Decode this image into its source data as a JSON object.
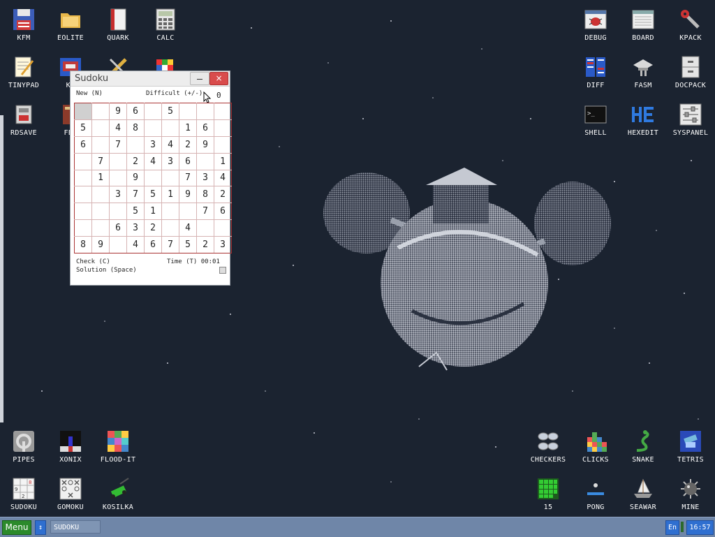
{
  "colors": {
    "desktop": "#1b2330",
    "taskbar": "#6f86a8",
    "menu_green": "#2b8a2b",
    "accent_blue": "#2f6fd0",
    "grid_red": "#aa3333"
  },
  "desktop_icons": {
    "left": [
      {
        "label": "KFM",
        "icon": "floppy-icon"
      },
      {
        "label": "EOLITE",
        "icon": "folder-icon"
      },
      {
        "label": "QUARK",
        "icon": "notebook-icon"
      },
      {
        "label": "CALC",
        "icon": "calculator-icon"
      },
      {
        "label": "TINYPAD",
        "icon": "notepad-icon"
      },
      {
        "label": "KF",
        "icon": "kf-icon"
      },
      {
        "label": "RDSAVE",
        "icon": "disk-save-icon"
      },
      {
        "label": "FB2",
        "icon": "book-icon"
      }
    ],
    "right": [
      {
        "label": "DEBUG",
        "icon": "bug-icon"
      },
      {
        "label": "BOARD",
        "icon": "board-icon"
      },
      {
        "label": "KPACK",
        "icon": "wrench-icon"
      },
      {
        "label": "DIFF",
        "icon": "diff-icon"
      },
      {
        "label": "FASM",
        "icon": "fasm-icon"
      },
      {
        "label": "DOCPACK",
        "icon": "cabinet-icon"
      },
      {
        "label": "SHELL",
        "icon": "terminal-icon"
      },
      {
        "label": "HEXEDIT",
        "icon": "hex-icon"
      },
      {
        "label": "SYSPANEL",
        "icon": "sliders-icon"
      }
    ],
    "bottom_left": [
      {
        "label": "PIPES",
        "icon": "pipes-icon"
      },
      {
        "label": "XONIX",
        "icon": "xonix-icon"
      },
      {
        "label": "FLOOD-IT",
        "icon": "flood-icon"
      },
      {
        "label": "SUDOKU",
        "icon": "sudoku-icon"
      },
      {
        "label": "GOMOKU",
        "icon": "gomoku-icon"
      },
      {
        "label": "KOSILKA",
        "icon": "mower-icon"
      }
    ],
    "bottom_right": [
      {
        "label": "CHECKERS",
        "icon": "checkers-icon"
      },
      {
        "label": "CLICKS",
        "icon": "clicks-icon"
      },
      {
        "label": "SNAKE",
        "icon": "snake-icon"
      },
      {
        "label": "TETRIS",
        "icon": "tetris-icon"
      },
      {
        "label": "15",
        "icon": "fifteen-icon"
      },
      {
        "label": "PONG",
        "icon": "pong-icon"
      },
      {
        "label": "SEAWAR",
        "icon": "seawar-icon"
      },
      {
        "label": "MINE",
        "icon": "mine-icon"
      }
    ]
  },
  "sudoku": {
    "title": "Sudoku",
    "new_label": "New (N)",
    "difficulty_label": "Difficult (+/-)",
    "difficulty_value": "0",
    "check_label": "Check (C)",
    "solution_label": "Solution (Space)",
    "time_label": "Time (T) 00:01",
    "grid": [
      [
        "",
        "",
        "9",
        "6",
        "",
        "5",
        "",
        "",
        ""
      ],
      [
        "5",
        "",
        "4",
        "8",
        "",
        "",
        "1",
        "6",
        ""
      ],
      [
        "6",
        "",
        "7",
        "",
        "3",
        "4",
        "2",
        "9",
        ""
      ],
      [
        "",
        "7",
        "",
        "2",
        "4",
        "3",
        "6",
        "",
        "1"
      ],
      [
        "",
        "1",
        "",
        "9",
        "",
        "",
        "7",
        "3",
        "4"
      ],
      [
        "",
        "",
        "3",
        "7",
        "5",
        "1",
        "9",
        "8",
        "2"
      ],
      [
        "",
        "",
        "",
        "5",
        "1",
        "",
        "",
        "7",
        "6"
      ],
      [
        "",
        "",
        "6",
        "3",
        "2",
        "",
        "4",
        "",
        ""
      ],
      [
        "8",
        "9",
        "",
        "4",
        "6",
        "7",
        "5",
        "2",
        "3"
      ]
    ]
  },
  "taskbar": {
    "menu_label": "Menu",
    "switch_icon": "↕",
    "task_label": "SUDOKU",
    "lang": "En",
    "clock": "16:57"
  }
}
